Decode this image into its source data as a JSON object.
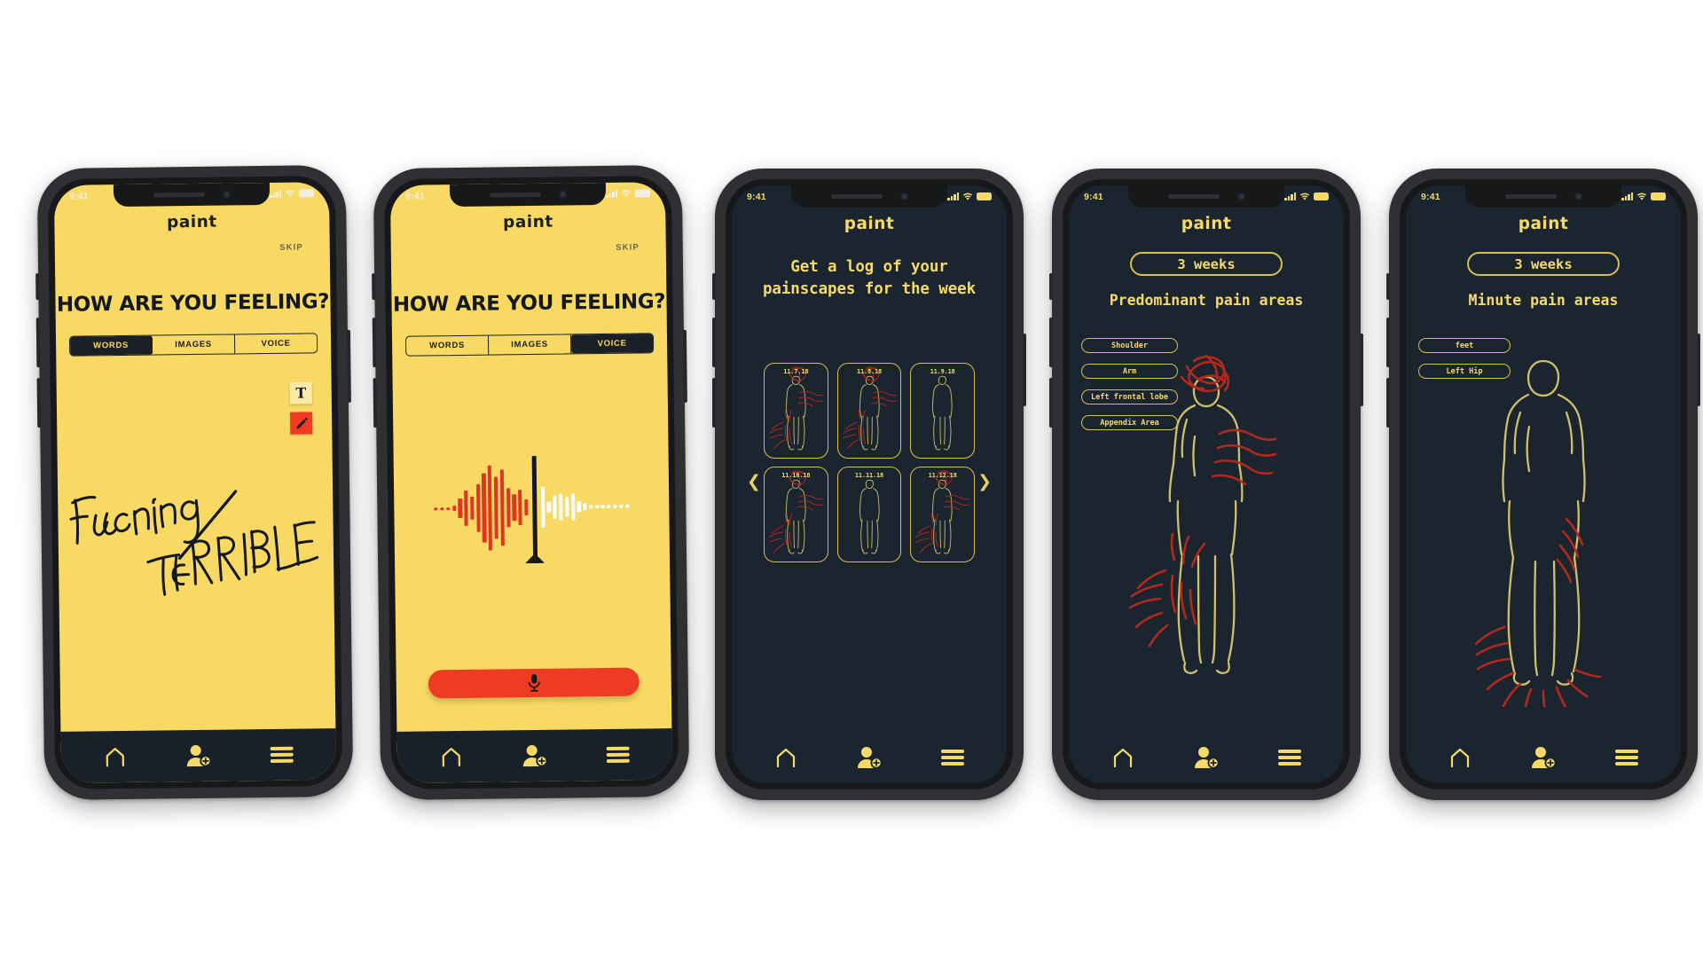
{
  "app": {
    "brand": "paint",
    "accent_yellow": "#f5da6a",
    "screen_yellow": "#f8d964",
    "dark_navy": "#1a2530",
    "accent_red": "#ef3b24",
    "ink": "#1b2026"
  },
  "status_bar": {
    "time": "9:41",
    "icons": [
      "signal-bars",
      "wifi",
      "battery"
    ]
  },
  "bottom_nav": {
    "items": [
      {
        "name": "home",
        "icon": "home-icon"
      },
      {
        "name": "add-contact",
        "icon": "add-person-icon"
      },
      {
        "name": "menu",
        "icon": "hamburger-menu-icon"
      }
    ]
  },
  "screens": [
    {
      "id": "words-entry",
      "theme": "light",
      "brand": "paint",
      "skip_label": "SKIP",
      "question": "HOW ARE YOU FEELING?",
      "tabs": [
        {
          "label": "WORDS",
          "active": true
        },
        {
          "label": "IMAGES",
          "active": false
        },
        {
          "label": "VOICE",
          "active": false
        }
      ],
      "tools": [
        {
          "name": "text-tool",
          "glyph": "T",
          "active": false
        },
        {
          "name": "pencil-tool",
          "glyph": "pencil-icon",
          "active": true
        }
      ],
      "handwriting": "Fucking TERRIBLE"
    },
    {
      "id": "voice-entry",
      "theme": "light",
      "brand": "paint",
      "skip_label": "SKIP",
      "question": "HOW ARE YOU FEELING?",
      "tabs": [
        {
          "label": "WORDS",
          "active": false
        },
        {
          "label": "IMAGES",
          "active": false
        },
        {
          "label": "VOICE",
          "active": true
        }
      ],
      "record_button": {
        "icon": "microphone-icon",
        "color": "#ef3b24"
      },
      "waveform": {
        "played_color": "#e03523",
        "remaining_color": "#ffffff",
        "played": [
          3,
          3,
          3,
          6,
          22,
          40,
          26,
          54,
          78,
          96,
          70,
          86,
          44,
          30,
          40,
          18
        ],
        "remaining": [
          46,
          12,
          26,
          30,
          22,
          30,
          12,
          8,
          4,
          4,
          4,
          4,
          4,
          4,
          4
        ]
      }
    },
    {
      "id": "weekly-log",
      "theme": "dark",
      "brand": "paint",
      "headline": "Get a log of your\npainscapes for the week",
      "carousel": {
        "prev_icon": "chevron-left-icon",
        "next_icon": "chevron-right-icon"
      },
      "log_entries": [
        {
          "date": "11.7.18",
          "pain": "heavy"
        },
        {
          "date": "11.8.18",
          "pain": "heavy"
        },
        {
          "date": "11.9.18",
          "pain": "none"
        },
        {
          "date": "11.10.18",
          "pain": "heavy"
        },
        {
          "date": "11.11.18",
          "pain": "none"
        },
        {
          "date": "11.12.18",
          "pain": "heavy"
        }
      ]
    },
    {
      "id": "predominant-pain",
      "theme": "dark",
      "brand": "paint",
      "range_pill": "3 weeks",
      "section_title": "Predominant pain areas",
      "tags": [
        "Shoulder",
        "Arm",
        "Left frontal lobe",
        "Appendix Area"
      ]
    },
    {
      "id": "minute-pain",
      "theme": "dark",
      "brand": "paint",
      "range_pill": "3 weeks",
      "section_title": "Minute pain areas",
      "tags": [
        "feet",
        "Left Hip"
      ]
    }
  ]
}
